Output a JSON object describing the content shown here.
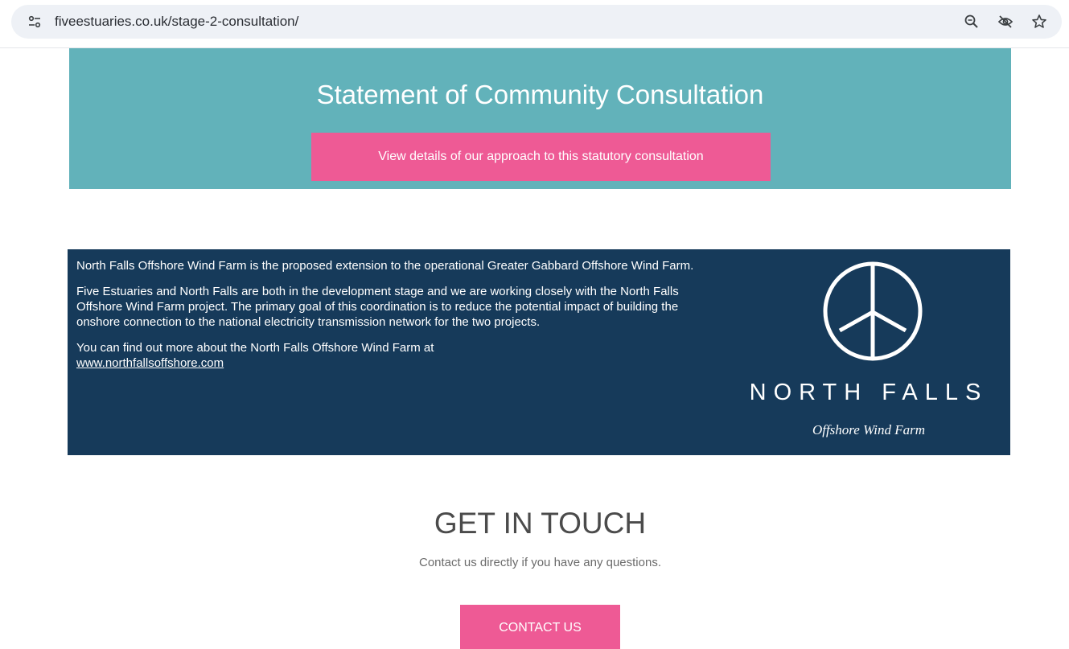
{
  "browser": {
    "url": "fiveestuaries.co.uk/stage-2-consultation/",
    "icons": [
      "site-settings-icon",
      "zoom-icon",
      "eye-slash-icon",
      "bookmark-star-icon"
    ]
  },
  "consultation": {
    "title": "Statement of Community Consultation",
    "button_label": "View details of our approach to this statutory consultation",
    "background_color": "#62b2ba",
    "button_color": "#ee5a95"
  },
  "north_falls": {
    "paragraph1": "North Falls Offshore Wind Farm is the proposed extension to the operational Greater Gabbard Offshore Wind Farm.",
    "paragraph2": "Five Estuaries and North Falls are both in the development stage and we are working closely with the North Falls Offshore Wind Farm project. The primary goal of this coordination is to reduce the potential impact of building the onshore connection to the national electricity transmission network for the two projects.",
    "paragraph3": "You can find out more about the North Falls Offshore Wind Farm at",
    "link_text": "www.northfallsoffshore.com",
    "logo_name": "NORTH FALLS",
    "logo_subtitle": "Offshore Wind Farm",
    "background_color": "#163a5a"
  },
  "get_in_touch": {
    "title": "GET IN TOUCH",
    "subtitle": "Contact us directly if you have any questions.",
    "button_label": "CONTACT US"
  }
}
